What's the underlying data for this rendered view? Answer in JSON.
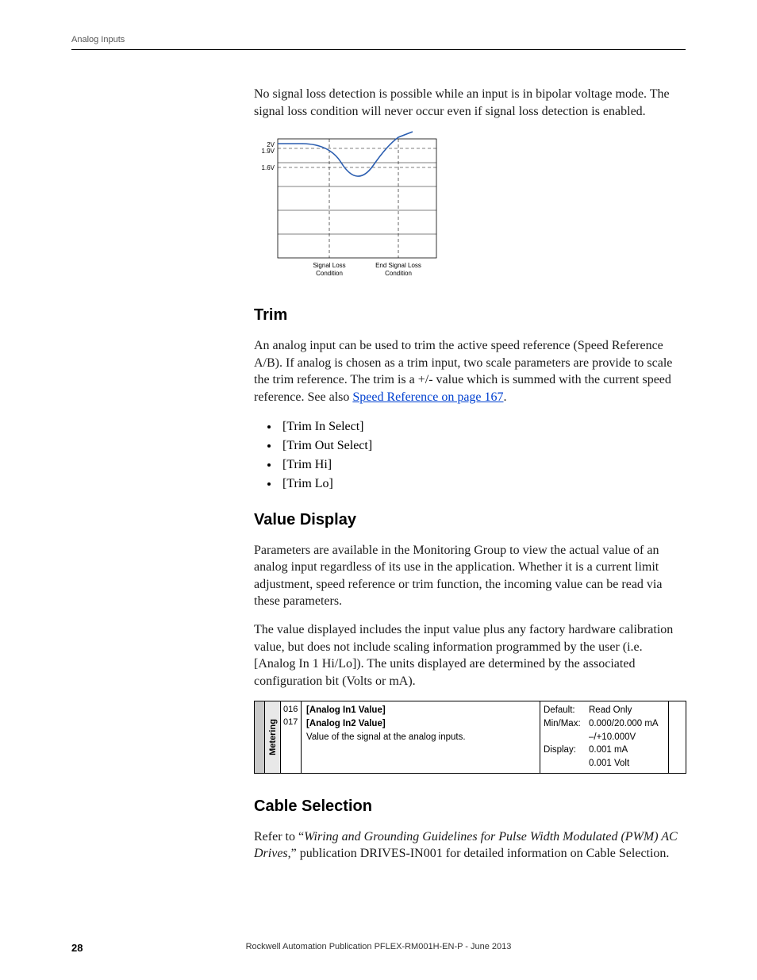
{
  "header": {
    "section": "Analog Inputs"
  },
  "intro": "No signal loss detection is possible while an input is in bipolar voltage mode. The signal loss condition will never occur even if signal loss detection is enabled.",
  "chart_data": {
    "type": "line",
    "y_ticks": [
      "2V",
      "1.9V",
      "1.6V"
    ],
    "x_labels": [
      "Signal Loss Condition",
      "End Signal Loss Condition"
    ],
    "ylim": [
      0,
      2.1
    ],
    "title": "",
    "xlabel": "",
    "ylabel": ""
  },
  "trim": {
    "heading": "Trim",
    "body": "An analog input can be used to trim the active speed reference (Speed Reference A/B). If analog is chosen as a trim input, two scale parameters are provide to scale the trim reference. The trim is a +/- value which is summed with the current speed reference. See also ",
    "link_text": "Speed Reference on page 167",
    "body_tail": ".",
    "items": [
      "[Trim In Select]",
      "[Trim Out Select]",
      "[Trim Hi]",
      "[Trim Lo]"
    ]
  },
  "value_disp": {
    "heading": "Value Display",
    "p1": "Parameters are available in the Monitoring Group to view the actual value of an analog input regardless of its use in the application. Whether it is a current limit adjustment, speed reference or trim function, the incoming value can be read via these parameters.",
    "p2": "The value displayed includes the input value plus any factory hardware calibration value, but does not include scaling information programmed by the user (i.e. [Analog In 1 Hi/Lo]). The units displayed are determined by the associated configuration bit (Volts or mA)."
  },
  "param_table": {
    "group": "Metering",
    "num1": "016",
    "num2": "017",
    "name1": "[Analog In1 Value]",
    "name2": "[Analog In2 Value]",
    "desc": "Value of the signal at the analog inputs.",
    "l_default": "Default:",
    "l_minmax": "Min/Max:",
    "l_display": "Display:",
    "v_default": "Read Only",
    "v_minmax1": "0.000/20.000 mA",
    "v_minmax2": "–/+10.000V",
    "v_disp1": "0.001 mA",
    "v_disp2": "0.001 Volt"
  },
  "cable": {
    "heading": "Cable Selection",
    "pre": "Refer to “",
    "italic": "Wiring and Grounding Guidelines for Pulse Width Modulated (PWM) AC Drives",
    "post": ",” publication DRIVES-IN001 for detailed information on Cable Selection."
  },
  "footer": {
    "text": "Rockwell Automation Publication PFLEX-RM001H-EN-P - June 2013",
    "page": "28"
  }
}
